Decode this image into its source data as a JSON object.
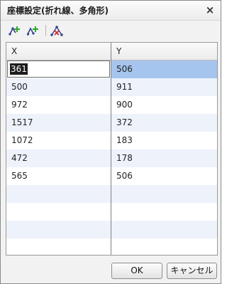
{
  "dialog": {
    "title": "座標設定(折れ線、多角形)",
    "close_symbol": "×"
  },
  "toolbar": {
    "icons": [
      "add-point-icon",
      "insert-point-icon",
      "delete-point-icon"
    ]
  },
  "grid": {
    "columns": [
      "X",
      "Y"
    ],
    "rows": [
      {
        "x": "361",
        "y": "506"
      },
      {
        "x": "500",
        "y": "911"
      },
      {
        "x": "972",
        "y": "900"
      },
      {
        "x": "1517",
        "y": "372"
      },
      {
        "x": "1072",
        "y": "183"
      },
      {
        "x": "472",
        "y": "178"
      },
      {
        "x": "565",
        "y": "506"
      }
    ]
  },
  "buttons": {
    "ok": "OK",
    "cancel": "キャンセル"
  },
  "colors": {
    "selection": "#a6c5ee",
    "alt_row": "#eef2fb"
  }
}
